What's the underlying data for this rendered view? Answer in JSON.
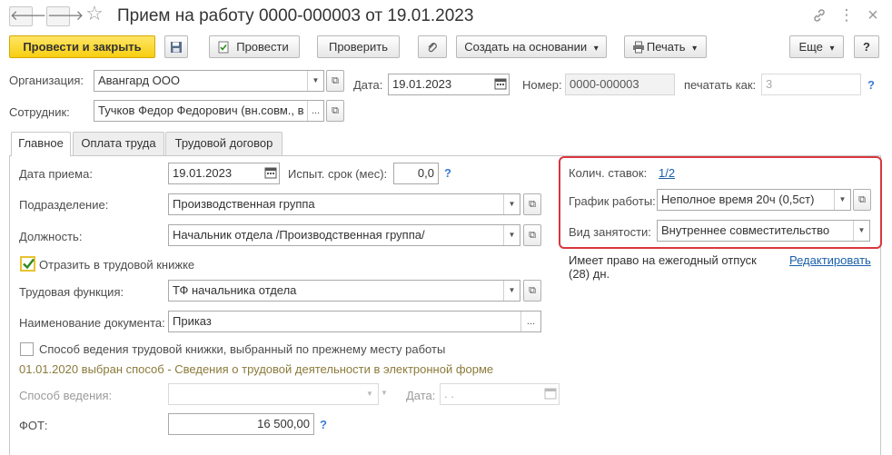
{
  "window": {
    "title": "Прием на работу 0000-000003 от 19.01.2023",
    "nav_back": "🡐",
    "nav_forward": "🡒",
    "star_icon": "☆",
    "link_icon": "🔗",
    "more_icon": "⋮",
    "close_icon": "×"
  },
  "toolbar": {
    "post_and_close": "Провести и закрыть",
    "post": "Провести",
    "check": "Проверить",
    "create_based_on": "Создать на основании",
    "print": "Печать",
    "more": "Еще",
    "help": "?",
    "dropdown_arrow": "▾"
  },
  "header": {
    "organization_label": "Организация:",
    "organization_value": "Авангард ООО",
    "date_label": "Дата:",
    "date_value": "19.01.2023",
    "number_label": "Номер:",
    "number_value": "0000-000003",
    "print_as_label": "печатать как:",
    "print_as_value": "3",
    "employee_label": "Сотрудник:",
    "employee_value": "Тучков Федор Федорович (вн.совм., в",
    "ellipsis": "...",
    "help": "?"
  },
  "tabs": [
    {
      "label": "Главное"
    },
    {
      "label": "Оплата труда"
    },
    {
      "label": "Трудовой договор"
    }
  ],
  "main": {
    "hire_date_label": "Дата приема:",
    "hire_date_value": "19.01.2023",
    "probation_label": "Испыт. срок (мес):",
    "probation_value": "0,0",
    "department_label": "Подразделение:",
    "department_value": "Производственная группа",
    "position_label": "Должность:",
    "position_value": "Начальник отдела /Производственная группа/",
    "work_book_label": "Отразить в трудовой книжке",
    "work_function_label": "Трудовая функция:",
    "work_function_value": "ТФ начальника отдела",
    "doc_name_label": "Наименование документа:",
    "doc_name_value": "Приказ",
    "prev_method_label": "Способ ведения трудовой книжки, выбранный по прежнему месту работы",
    "method_info": "01.01.2020 выбран способ - Сведения о трудовой деятельности в электронной форме",
    "method_label": "Способ ведения:",
    "method_date_label": "Дата:",
    "method_date_value": " .  .",
    "fot_label": "ФОТ:",
    "fot_value": "16 500,00"
  },
  "right": {
    "rates_label": "Колич. ставок:",
    "rates_value": "1/2",
    "schedule_label": "График работы:",
    "schedule_value": "Неполное время 20ч (0,5ст)",
    "employment_label": "Вид занятости:",
    "employment_value": "Внутреннее совместительство",
    "vacation_text_1": "Имеет право на ежегодный отпуск",
    "vacation_text_2": "(28) дн.",
    "edit_link": "Редактировать"
  },
  "colors": {
    "primary_button": "#f7cf10",
    "highlight_border": "#d9363e",
    "link": "#1a5fa8",
    "checkbox_mark": "#2e8b1e",
    "info_text": "#8b7a3a"
  }
}
